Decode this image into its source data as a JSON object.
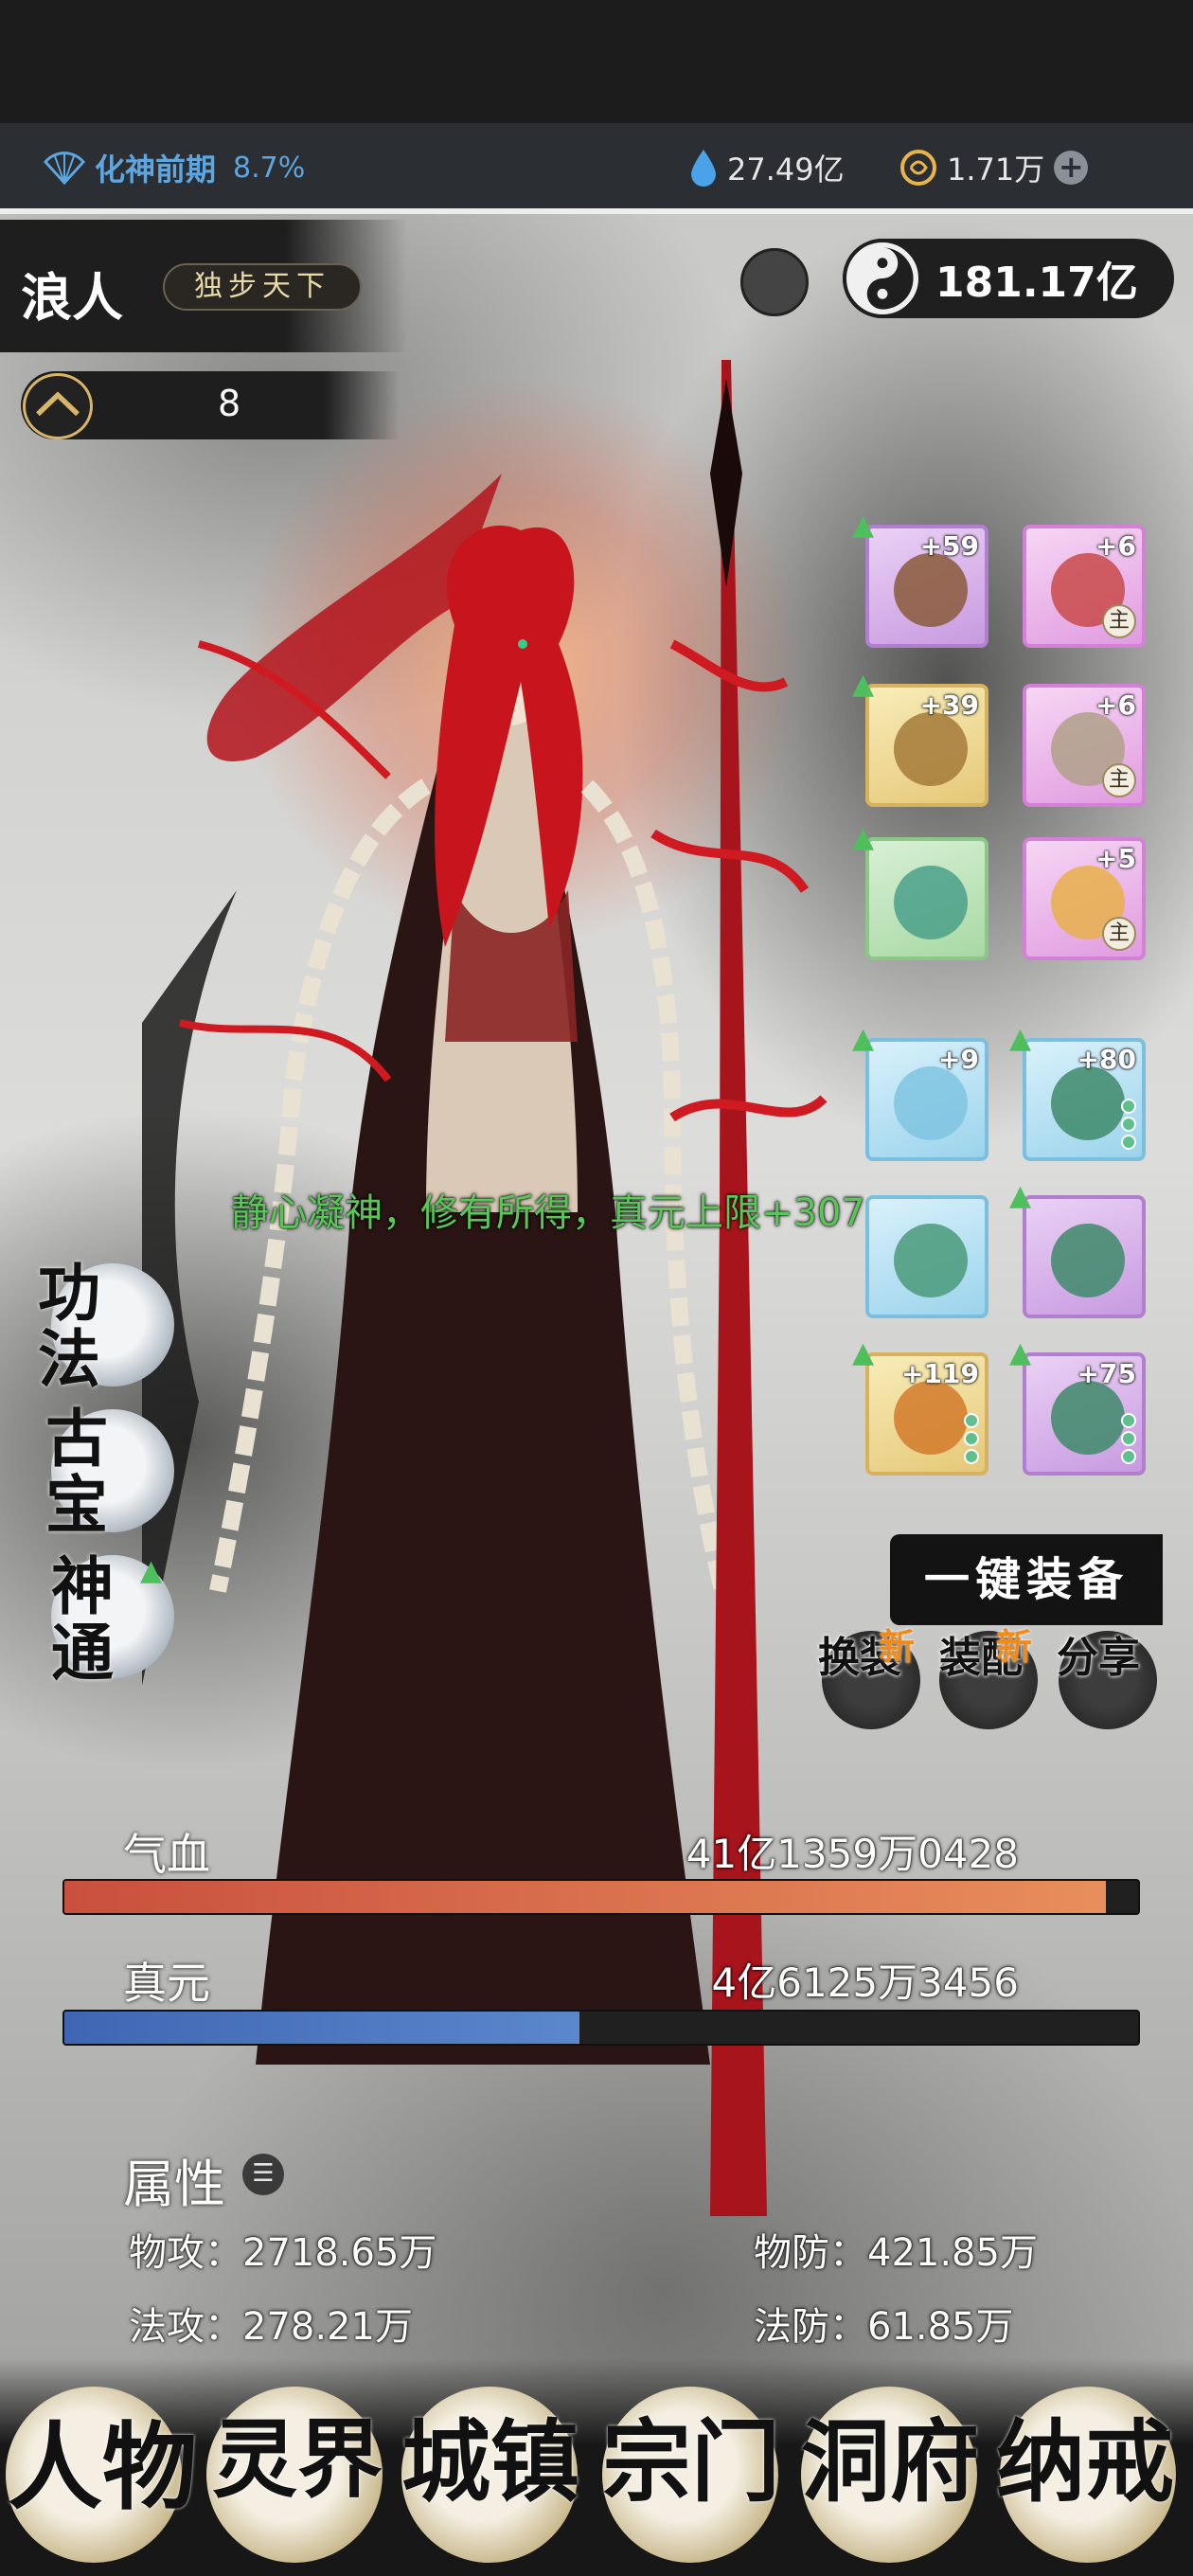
{
  "topbar": {
    "realm": "化神前期",
    "realm_progress": "8.7%",
    "spirit_stone": "27.49亿",
    "gold": "1.71万"
  },
  "character": {
    "name": "浪人",
    "title": "独步天下",
    "power": "181.17亿",
    "level": "8"
  },
  "equipment": {
    "left": [
      {
        "level": "+59",
        "rarity": "purple"
      },
      {
        "level": "+39",
        "rarity": "gold"
      },
      {
        "level": "",
        "rarity": "green"
      },
      {
        "level": "+9",
        "rarity": "blue"
      },
      {
        "level": "",
        "rarity": "blue"
      },
      {
        "level": "+119",
        "rarity": "gold"
      }
    ],
    "right": [
      {
        "level": "+6",
        "rarity": "pink",
        "tag": "主"
      },
      {
        "level": "+6",
        "rarity": "pink",
        "tag": "主"
      },
      {
        "level": "+5",
        "rarity": "pink",
        "tag": "主"
      },
      {
        "level": "+80",
        "rarity": "blue"
      },
      {
        "level": "",
        "rarity": "purple"
      },
      {
        "level": "+75",
        "rarity": "purple"
      }
    ]
  },
  "message": "静心凝神，修有所得，真元上限+307",
  "side_menu": {
    "skills": "功法",
    "treasure": "古宝",
    "magic": "神通"
  },
  "actions": {
    "equip_all": "一键装备",
    "swap": "换装",
    "assemble": "装配",
    "share": "分享",
    "new_badge": "新"
  },
  "stats": {
    "hp_label": "气血",
    "hp_value": "41亿1359万0428",
    "hp_ratio": 0.97,
    "mp_label": "真元",
    "mp_value": "4亿6125万3456",
    "mp_ratio": 0.48
  },
  "attributes": {
    "title": "属性",
    "phys_atk": "物攻：2718.65万",
    "phys_def": "物防：421.85万",
    "mag_atk": "法攻：278.21万",
    "mag_def": "法防：61.85万"
  },
  "nav": [
    "人物",
    "灵界",
    "城镇",
    "宗门",
    "洞府",
    "纳戒"
  ],
  "colors": {
    "accent_blue": "#5da6e0",
    "hp": "#c9503e",
    "mp": "#3f66b3",
    "message_green": "#58c757"
  }
}
